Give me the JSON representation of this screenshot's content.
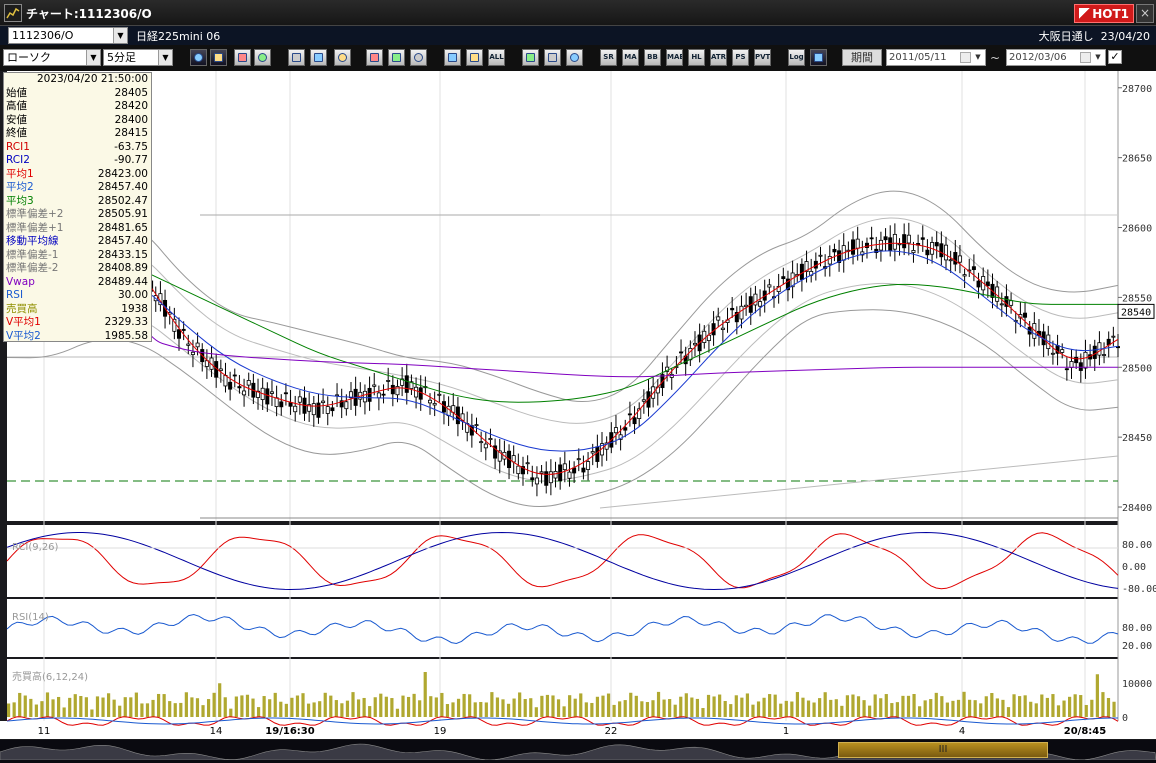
{
  "window": {
    "title": "チャート:1112306/O",
    "hot_label": "HOT1",
    "close_label": "×"
  },
  "header": {
    "symbol_code": "1112306/O",
    "instrument": "日経225mini 06",
    "session": "大阪日通し",
    "date": "23/04/20"
  },
  "toolbar": {
    "chart_type": "ローソク",
    "interval": "5分足",
    "buttons": [
      "zoom",
      "crosshair",
      "line-tool",
      "refresh",
      "compare",
      "indicator",
      "clear",
      "pencil",
      "cursor",
      "undo",
      "candle-l",
      "candle-r",
      "all",
      "gear",
      "wrench",
      "palette",
      "sr",
      "MA",
      "BB",
      "MAE",
      "HL",
      "ATR",
      "ps",
      "PVT",
      "Log",
      "export"
    ],
    "button_labels": {
      "sr": "SR",
      "MA": "MA",
      "BB": "BB",
      "MAE": "MAE",
      "HL": "HL",
      "ATR": "ATR",
      "ps": "PS",
      "PVT": "PVT",
      "Log": "Log",
      "all": "ALL"
    },
    "period_label": "期間",
    "date_from": "2011/05/11",
    "date_to": "2012/03/06",
    "tilde": "~",
    "check": "✓"
  },
  "info_panel": {
    "datetime": "2023/04/20  21:50:00",
    "rows": [
      {
        "label": "始値",
        "value": "28405",
        "color": "#000000"
      },
      {
        "label": "高値",
        "value": "28420",
        "color": "#000000"
      },
      {
        "label": "安値",
        "value": "28400",
        "color": "#000000"
      },
      {
        "label": "終値",
        "value": "28415",
        "color": "#000000"
      },
      {
        "label": "RCI1",
        "value": "-63.75",
        "color": "#d00000"
      },
      {
        "label": "RCI2",
        "value": "-90.77",
        "color": "#0000c0"
      },
      {
        "label": "平均1",
        "value": "28423.00",
        "color": "#e00000"
      },
      {
        "label": "平均2",
        "value": "28457.40",
        "color": "#1a5ad0"
      },
      {
        "label": "平均3",
        "value": "28502.47",
        "color": "#008000"
      },
      {
        "label": "標準偏差+2",
        "value": "28505.91",
        "color": "#777777"
      },
      {
        "label": "標準偏差+1",
        "value": "28481.65",
        "color": "#777777"
      },
      {
        "label": "移動平均線",
        "value": "28457.40",
        "color": "#0000c0"
      },
      {
        "label": "標準偏差-1",
        "value": "28433.15",
        "color": "#777777"
      },
      {
        "label": "標準偏差-2",
        "value": "28408.89",
        "color": "#777777"
      },
      {
        "label": "Vwap",
        "value": "28489.44",
        "color": "#8000c0"
      },
      {
        "label": "RSI",
        "value": "30.00",
        "color": "#1a5ad0"
      },
      {
        "label": "売買高",
        "value": "1938",
        "color": "#909000"
      },
      {
        "label": "V平均1",
        "value": "2329.33",
        "color": "#e00000"
      },
      {
        "label": "V平均2",
        "value": "1985.58",
        "color": "#1a5ad0"
      }
    ]
  },
  "panels": {
    "rci": {
      "label": "RCI(9,26)",
      "ticks": [
        "80.00",
        "0.00",
        "-80.00"
      ]
    },
    "rsi": {
      "label": "RSI(14)",
      "ticks": [
        "80.00",
        "20.00"
      ]
    },
    "volume": {
      "label": "売買高(6,12,24)",
      "ticks": [
        "10000",
        "0"
      ]
    }
  },
  "chart_data": {
    "type": "line",
    "price_axis": {
      "ticks": [
        28400,
        28450,
        28500,
        28550,
        28600,
        28650,
        28700
      ],
      "ylim": [
        28390,
        28712
      ],
      "current_price": "28540"
    },
    "x_ticks": [
      "11",
      "14",
      "19/16:30",
      "19",
      "22",
      "1",
      "4",
      "20/8:45"
    ],
    "series": [
      {
        "name": "平均1",
        "values": [
          28555,
          28560,
          28600,
          28570,
          28520,
          28490,
          28478,
          28470,
          28480,
          28488,
          28470,
          28440,
          28420,
          28430,
          28460,
          28500,
          28530,
          28550,
          28570,
          28585,
          28590,
          28585,
          28560,
          28530,
          28500,
          28520
        ]
      },
      {
        "name": "平均2",
        "values": [
          28535,
          28545,
          28565,
          28560,
          28530,
          28505,
          28490,
          28480,
          28478,
          28478,
          28465,
          28450,
          28440,
          28440,
          28450,
          28480,
          28515,
          28545,
          28565,
          28580,
          28585,
          28575,
          28550,
          28525,
          28510,
          28515
        ]
      },
      {
        "name": "平均3",
        "values": [
          28600,
          28595,
          28585,
          28570,
          28555,
          28540,
          28525,
          28510,
          28500,
          28490,
          28480,
          28475,
          28475,
          28478,
          28485,
          28500,
          28515,
          28530,
          28545,
          28555,
          28560,
          28558,
          28552,
          28545,
          28545,
          28545
        ]
      },
      {
        "name": "Vwap",
        "values": [
          28630,
          28628,
          28622,
          28522,
          28512,
          28508,
          28506,
          28504,
          28503,
          28502,
          28500,
          28498,
          28496,
          28494,
          28493,
          28494,
          28496,
          28497,
          28498,
          28499,
          28500,
          28500,
          28500,
          28500,
          28500,
          28500
        ]
      }
    ],
    "volume_highlights": [
      {
        "x": "14",
        "value": 7500
      },
      {
        "x": "19",
        "value": 10000
      },
      {
        "x": "20/8:45",
        "value": 9500
      }
    ]
  },
  "scrollbar": {
    "thumb_label": "III"
  }
}
